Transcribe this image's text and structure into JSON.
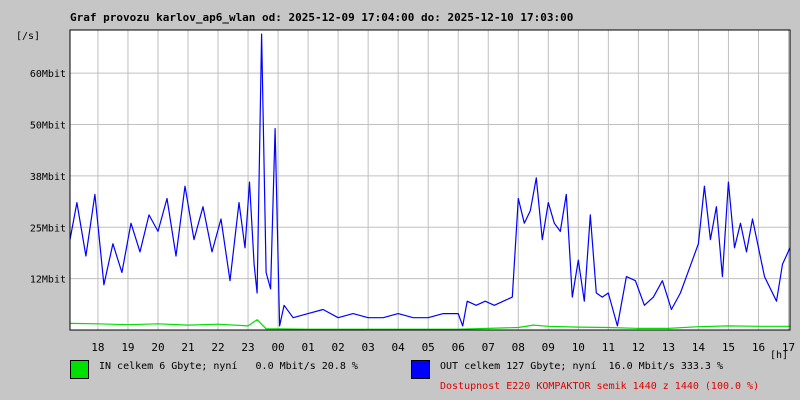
{
  "header": {
    "title": "Graf provozu karlov_ap6_wlan od: 2025-12-09 17:04:00 do: 2025-12-10 17:03:00"
  },
  "legend": {
    "in_text": "IN celkem 6 Gbyte; nyní   0.0 Mbit/s 20.8 %",
    "out_text": "OUT celkem 127 Gbyte; nyní  16.0 Mbit/s 333.3 %",
    "availability": "Dostupnost E220 KOMPAKTOR semik 1440 z 1440 (100.0 %)"
  },
  "colors": {
    "in": "#00e000",
    "out": "#0000ff",
    "availability": "#e00000",
    "grid": "#c0c0c0",
    "plot_bg": "#ffffff",
    "page_bg": "#c6c6c6"
  },
  "chart_data": {
    "type": "line",
    "ylabel": "[/s]",
    "xlabel": "[h]",
    "ylim": [
      0,
      73
    ],
    "yticks": [
      {
        "value": 12.5,
        "label": "12Mbit"
      },
      {
        "value": 25,
        "label": "25Mbit"
      },
      {
        "value": 37.5,
        "label": "38Mbit"
      },
      {
        "value": 50,
        "label": "50Mbit"
      },
      {
        "value": 62.5,
        "label": "60Mbit"
      }
    ],
    "xlim": [
      17.07,
      41.05
    ],
    "xticks": [
      {
        "value": 18,
        "label": "18"
      },
      {
        "value": 19,
        "label": "19"
      },
      {
        "value": 20,
        "label": "20"
      },
      {
        "value": 21,
        "label": "21"
      },
      {
        "value": 22,
        "label": "22"
      },
      {
        "value": 23,
        "label": "23"
      },
      {
        "value": 24,
        "label": "00"
      },
      {
        "value": 25,
        "label": "01"
      },
      {
        "value": 26,
        "label": "02"
      },
      {
        "value": 27,
        "label": "03"
      },
      {
        "value": 28,
        "label": "04"
      },
      {
        "value": 29,
        "label": "05"
      },
      {
        "value": 30,
        "label": "06"
      },
      {
        "value": 31,
        "label": "07"
      },
      {
        "value": 32,
        "label": "08"
      },
      {
        "value": 33,
        "label": "09"
      },
      {
        "value": 34,
        "label": "10"
      },
      {
        "value": 35,
        "label": "11"
      },
      {
        "value": 36,
        "label": "12"
      },
      {
        "value": 37,
        "label": "13"
      },
      {
        "value": 38,
        "label": "14"
      },
      {
        "value": 39,
        "label": "15"
      },
      {
        "value": 40,
        "label": "16"
      },
      {
        "value": 41,
        "label": "17"
      }
    ],
    "grid": true,
    "series": [
      {
        "name": "IN",
        "x": [
          17.07,
          18.0,
          19.0,
          20.0,
          21.0,
          22.0,
          23.0,
          23.3,
          23.6,
          24.0,
          25.0,
          26.0,
          27.0,
          28.0,
          29.0,
          30.0,
          31.0,
          32.0,
          32.5,
          33.0,
          34.0,
          35.0,
          36.0,
          37.0,
          38.0,
          39.0,
          40.0,
          41.05
        ],
        "y": [
          1.6,
          1.5,
          1.3,
          1.5,
          1.2,
          1.4,
          1.0,
          2.5,
          0.3,
          0.3,
          0.2,
          0.2,
          0.2,
          0.2,
          0.2,
          0.2,
          0.4,
          0.6,
          1.2,
          0.9,
          0.7,
          0.6,
          0.4,
          0.4,
          0.8,
          1.0,
          0.9,
          0.9
        ]
      },
      {
        "name": "OUT",
        "x": [
          17.07,
          17.3,
          17.6,
          17.9,
          18.2,
          18.5,
          18.8,
          19.1,
          19.4,
          19.7,
          20.0,
          20.3,
          20.6,
          20.9,
          21.2,
          21.5,
          21.8,
          22.1,
          22.4,
          22.7,
          22.9,
          23.05,
          23.2,
          23.3,
          23.45,
          23.6,
          23.75,
          23.9,
          24.05,
          24.2,
          24.5,
          25.0,
          25.5,
          26.0,
          26.5,
          27.0,
          27.5,
          28.0,
          28.5,
          29.0,
          29.5,
          30.0,
          30.15,
          30.3,
          30.6,
          30.9,
          31.2,
          31.5,
          31.8,
          32.0,
          32.2,
          32.4,
          32.6,
          32.8,
          33.0,
          33.2,
          33.4,
          33.6,
          33.8,
          34.0,
          34.2,
          34.4,
          34.6,
          34.8,
          35.0,
          35.3,
          35.6,
          35.9,
          36.2,
          36.5,
          36.8,
          37.1,
          37.4,
          37.7,
          38.0,
          38.2,
          38.4,
          38.6,
          38.8,
          39.0,
          39.2,
          39.4,
          39.6,
          39.8,
          40.0,
          40.2,
          40.4,
          40.6,
          40.8,
          41.05
        ],
        "y": [
          22,
          31,
          18,
          33,
          11,
          21,
          14,
          26,
          19,
          28,
          24,
          32,
          18,
          35,
          22,
          30,
          19,
          27,
          12,
          31,
          20,
          36,
          16,
          9,
          72,
          14,
          10,
          49,
          1,
          6,
          3,
          4,
          5,
          3,
          4,
          3,
          3,
          4,
          3,
          3,
          4,
          4,
          1,
          7,
          6,
          7,
          6,
          7,
          8,
          32,
          26,
          29,
          37,
          22,
          31,
          26,
          24,
          33,
          8,
          17,
          7,
          28,
          9,
          8,
          9,
          1,
          13,
          12,
          6,
          8,
          12,
          5,
          9,
          15,
          21,
          35,
          22,
          30,
          13,
          36,
          20,
          26,
          19,
          27,
          20,
          13,
          10,
          7,
          16,
          20
        ]
      }
    ]
  }
}
